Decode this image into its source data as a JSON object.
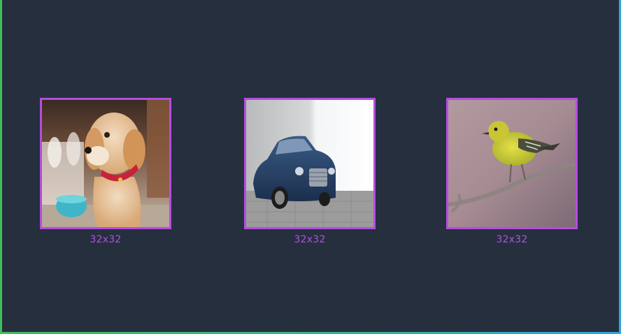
{
  "images": [
    {
      "subject": "puppy",
      "label": "32x32"
    },
    {
      "subject": "car",
      "label": "32x32"
    },
    {
      "subject": "bird",
      "label": "32x32"
    }
  ],
  "colors": {
    "background": "#262f3e",
    "thumbnail_border": "#b54de0",
    "caption": "#b24fe0",
    "frame_left": "#3dbf5a",
    "frame_right": "#2aa8d8"
  }
}
